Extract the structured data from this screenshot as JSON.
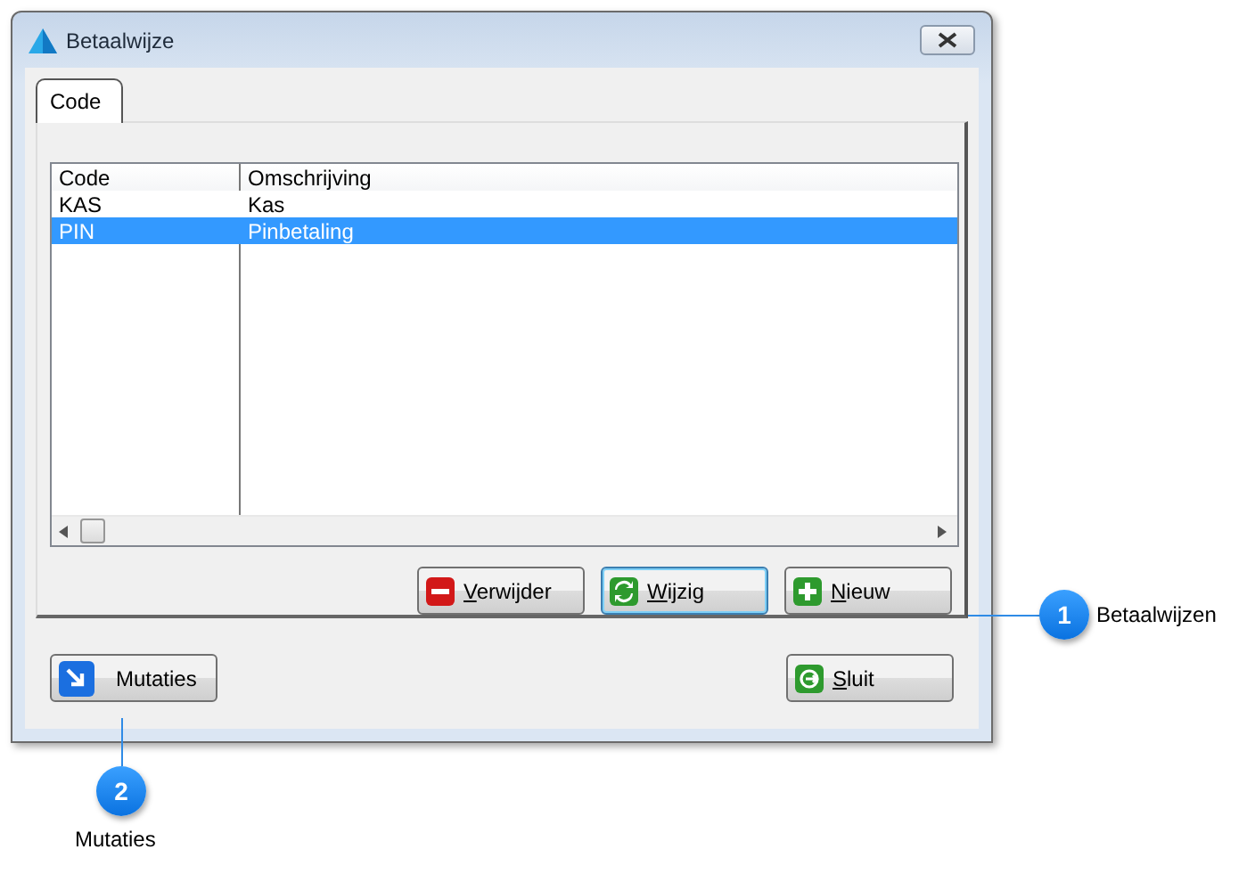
{
  "window": {
    "title": "Betaalwijze"
  },
  "tabs": [
    {
      "label": "Code",
      "selected": true
    }
  ],
  "table": {
    "columns": [
      "Code",
      "Omschrijving"
    ],
    "rows": [
      {
        "cells": [
          "KAS",
          "Kas"
        ],
        "selected": false
      },
      {
        "cells": [
          "PIN",
          "Pinbetaling"
        ],
        "selected": true
      }
    ]
  },
  "actions": [
    {
      "kind": "delete",
      "label": "Verwijder",
      "focused": false
    },
    {
      "kind": "edit",
      "label": "Wijzig",
      "focused": true
    },
    {
      "kind": "add",
      "label": "Nieuw",
      "focused": false
    }
  ],
  "footer": [
    {
      "kind": "mutations",
      "label": "Mutaties",
      "mnemonic": false
    },
    {
      "kind": "close",
      "label": "Sluit",
      "mnemonic": true
    }
  ],
  "callouts": [
    {
      "number": "1",
      "label": "Betaalwijzen"
    },
    {
      "number": "2",
      "label": "Mutaties"
    }
  ]
}
